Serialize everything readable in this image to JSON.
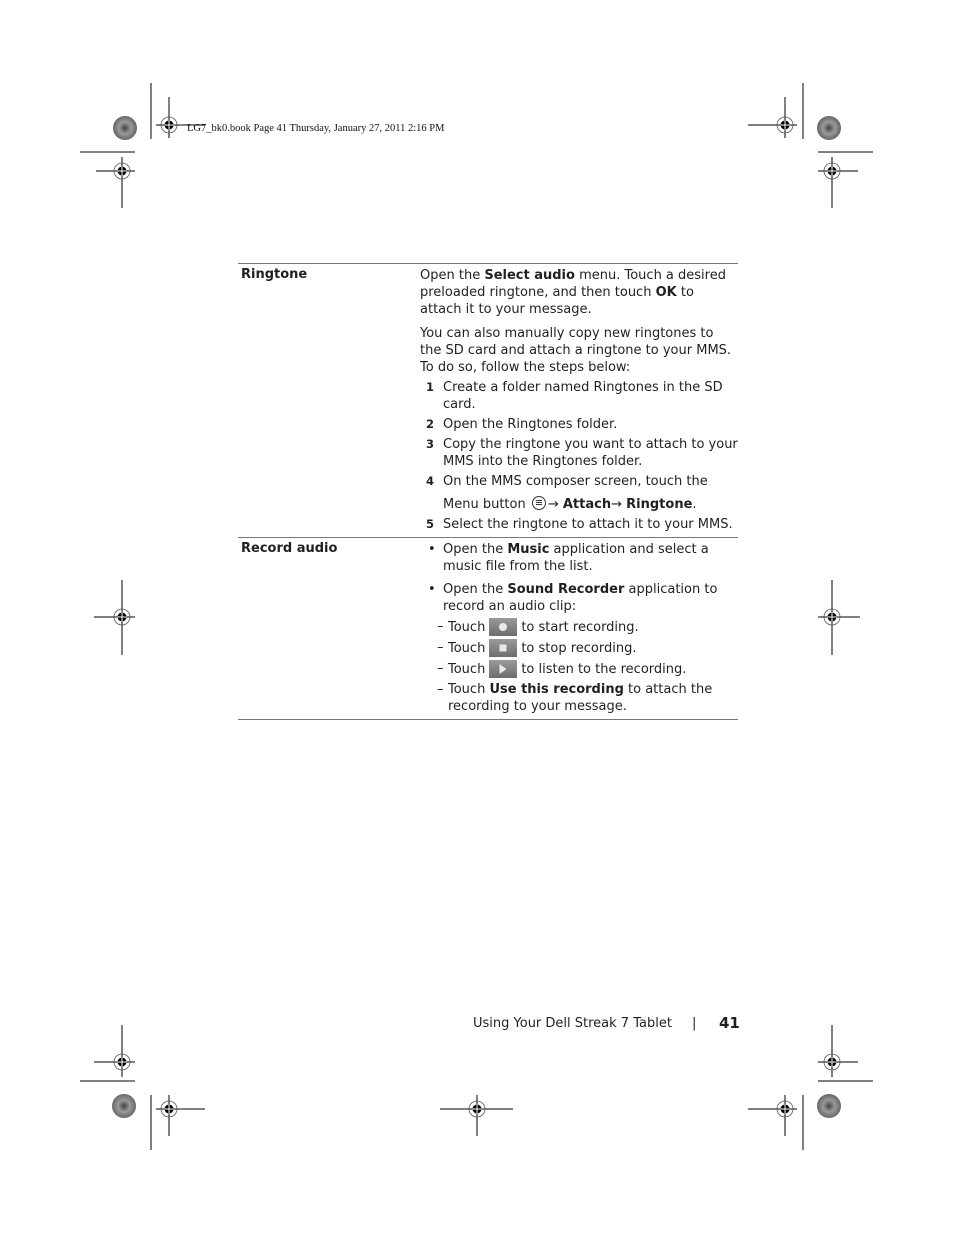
{
  "slug": "LG7_bk0.book  Page 41  Thursday, January 27, 2011  2:16 PM",
  "table": {
    "rows": [
      {
        "label": "Ringtone",
        "para1": {
          "t1": "Open the ",
          "b1": "Select audio",
          "t2": " menu. Touch a desired preloaded ringtone, and then touch ",
          "b2": "OK",
          "t3": " to attach it to your message."
        },
        "para2": "You can also manually copy new ringtones to the SD card and attach a ringtone to your MMS. To do so, follow the steps below:",
        "steps": [
          {
            "num": "1",
            "text": "Create a folder named Ringtones in the SD card."
          },
          {
            "num": "2",
            "text": "Open the Ringtones folder."
          },
          {
            "num": "3",
            "text": "Copy the ringtone you want to attach to your MMS into the Ringtones folder."
          },
          {
            "num": "4",
            "line1": "On the MMS composer screen, touch the",
            "pre": "Menu button ",
            "arrow1": "→ ",
            "b1": "Attach",
            "arrow2": "→ ",
            "b2": "Ringtone",
            "end": "."
          },
          {
            "num": "5",
            "text": "Select the ringtone to attach it to your MMS."
          }
        ]
      },
      {
        "label": "Record audio",
        "bullets": [
          {
            "dot": "•",
            "t1": "Open the ",
            "b1": "Music",
            "t2": " application and select a music file from the list."
          },
          {
            "dot": "•",
            "t1": "Open the ",
            "b1": "Sound Recorder",
            "t2": " application to record an audio clip:"
          }
        ],
        "dashes": [
          {
            "dash": "–",
            "pre": "Touch",
            "icon": "record-icon",
            "post": "to start recording."
          },
          {
            "dash": "–",
            "pre": "Touch",
            "icon": "stop-icon",
            "post": "to stop recording."
          },
          {
            "dash": "–",
            "pre": "Touch",
            "icon": "play-icon",
            "post": "to listen to the recording."
          },
          {
            "dash": "–",
            "pre": "Touch ",
            "b1": "Use this recording",
            "post": " to attach the recording to your message."
          }
        ]
      }
    ]
  },
  "footer": {
    "text": "Using Your Dell Streak 7 Tablet",
    "separator": "|",
    "page": "41"
  }
}
